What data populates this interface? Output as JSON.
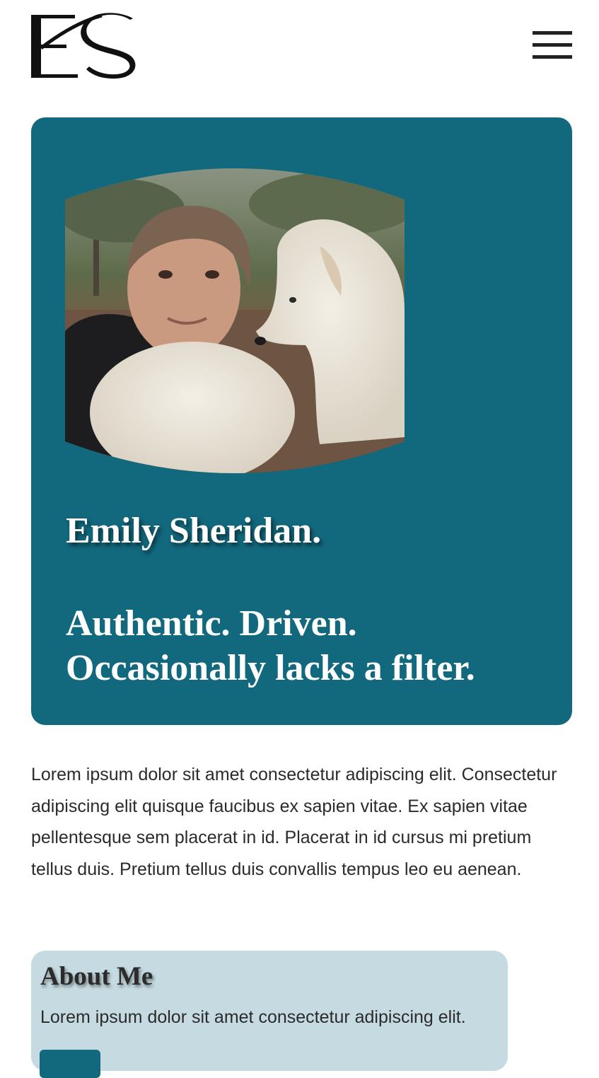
{
  "header": {
    "logo": {
      "text": "ES",
      "icon": "es-monogram-logo"
    },
    "menu_icon": "hamburger-menu-icon"
  },
  "hero": {
    "background_color": "#12687d",
    "photo_description_icon": "profile-photo",
    "title": "Emily Sheridan.",
    "tagline": "Authentic. Driven. Occasionally lacks a filter."
  },
  "intro": {
    "text": "Lorem ipsum dolor sit amet consectetur adipiscing elit. Consectetur adipiscing elit quisque faucibus ex sapien vitae. Ex sapien vitae pellentesque sem placerat in id. Placerat in id cursus mi pretium tellus duis. Pretium tellus duis convallis tempus leo eu aenean."
  },
  "about": {
    "background_color": "#c6dbe1",
    "title": "About Me",
    "text": "Lorem ipsum dolor sit amet consectetur adipiscing elit."
  }
}
